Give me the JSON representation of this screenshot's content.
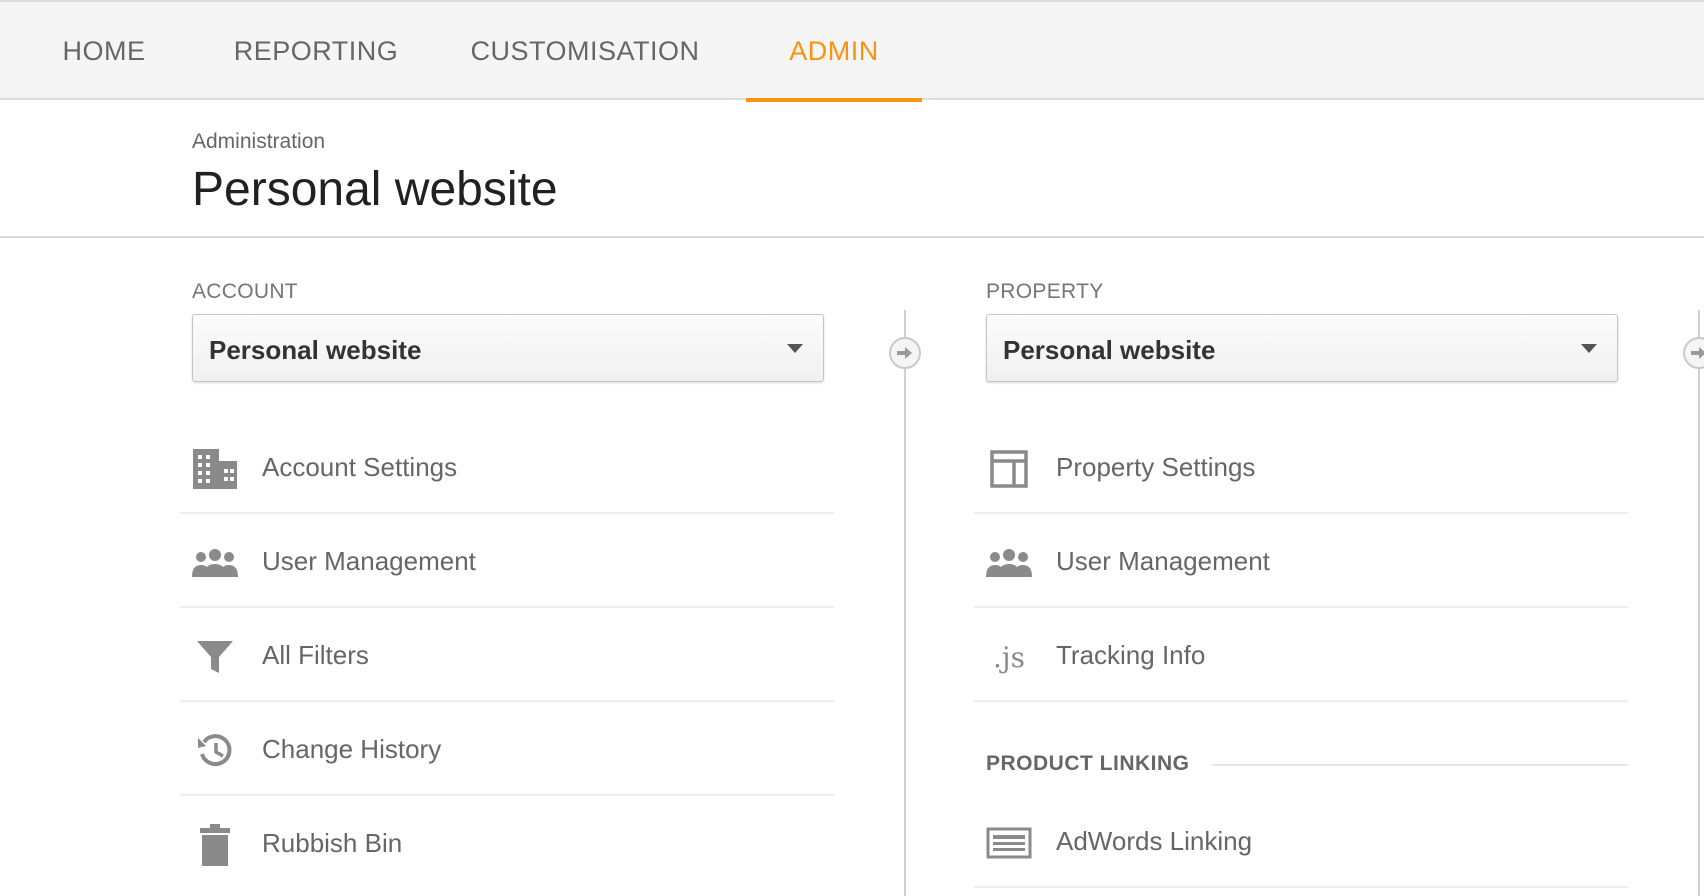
{
  "nav": {
    "tabs": [
      {
        "label": "HOME"
      },
      {
        "label": "REPORTING"
      },
      {
        "label": "CUSTOMISATION"
      },
      {
        "label": "ADMIN",
        "active": true
      }
    ],
    "accent_color": "#f8940f"
  },
  "header": {
    "breadcrumb": "Administration",
    "title": "Personal website"
  },
  "account": {
    "label": "ACCOUNT",
    "selected": "Personal website",
    "items": [
      {
        "label": "Account Settings",
        "icon": "building-icon"
      },
      {
        "label": "User Management",
        "icon": "users-icon"
      },
      {
        "label": "All Filters",
        "icon": "filter-icon"
      },
      {
        "label": "Change History",
        "icon": "history-icon"
      },
      {
        "label": "Rubbish Bin",
        "icon": "trash-icon"
      }
    ]
  },
  "property": {
    "label": "PROPERTY",
    "selected": "Personal website",
    "items": [
      {
        "label": "Property Settings",
        "icon": "layout-icon"
      },
      {
        "label": "User Management",
        "icon": "users-icon"
      },
      {
        "label": "Tracking Info",
        "icon": "js-icon",
        "glyph": ".js"
      }
    ],
    "section_heading": "PRODUCT LINKING",
    "linking_items": [
      {
        "label": "AdWords Linking",
        "icon": "adwords-icon"
      }
    ]
  }
}
